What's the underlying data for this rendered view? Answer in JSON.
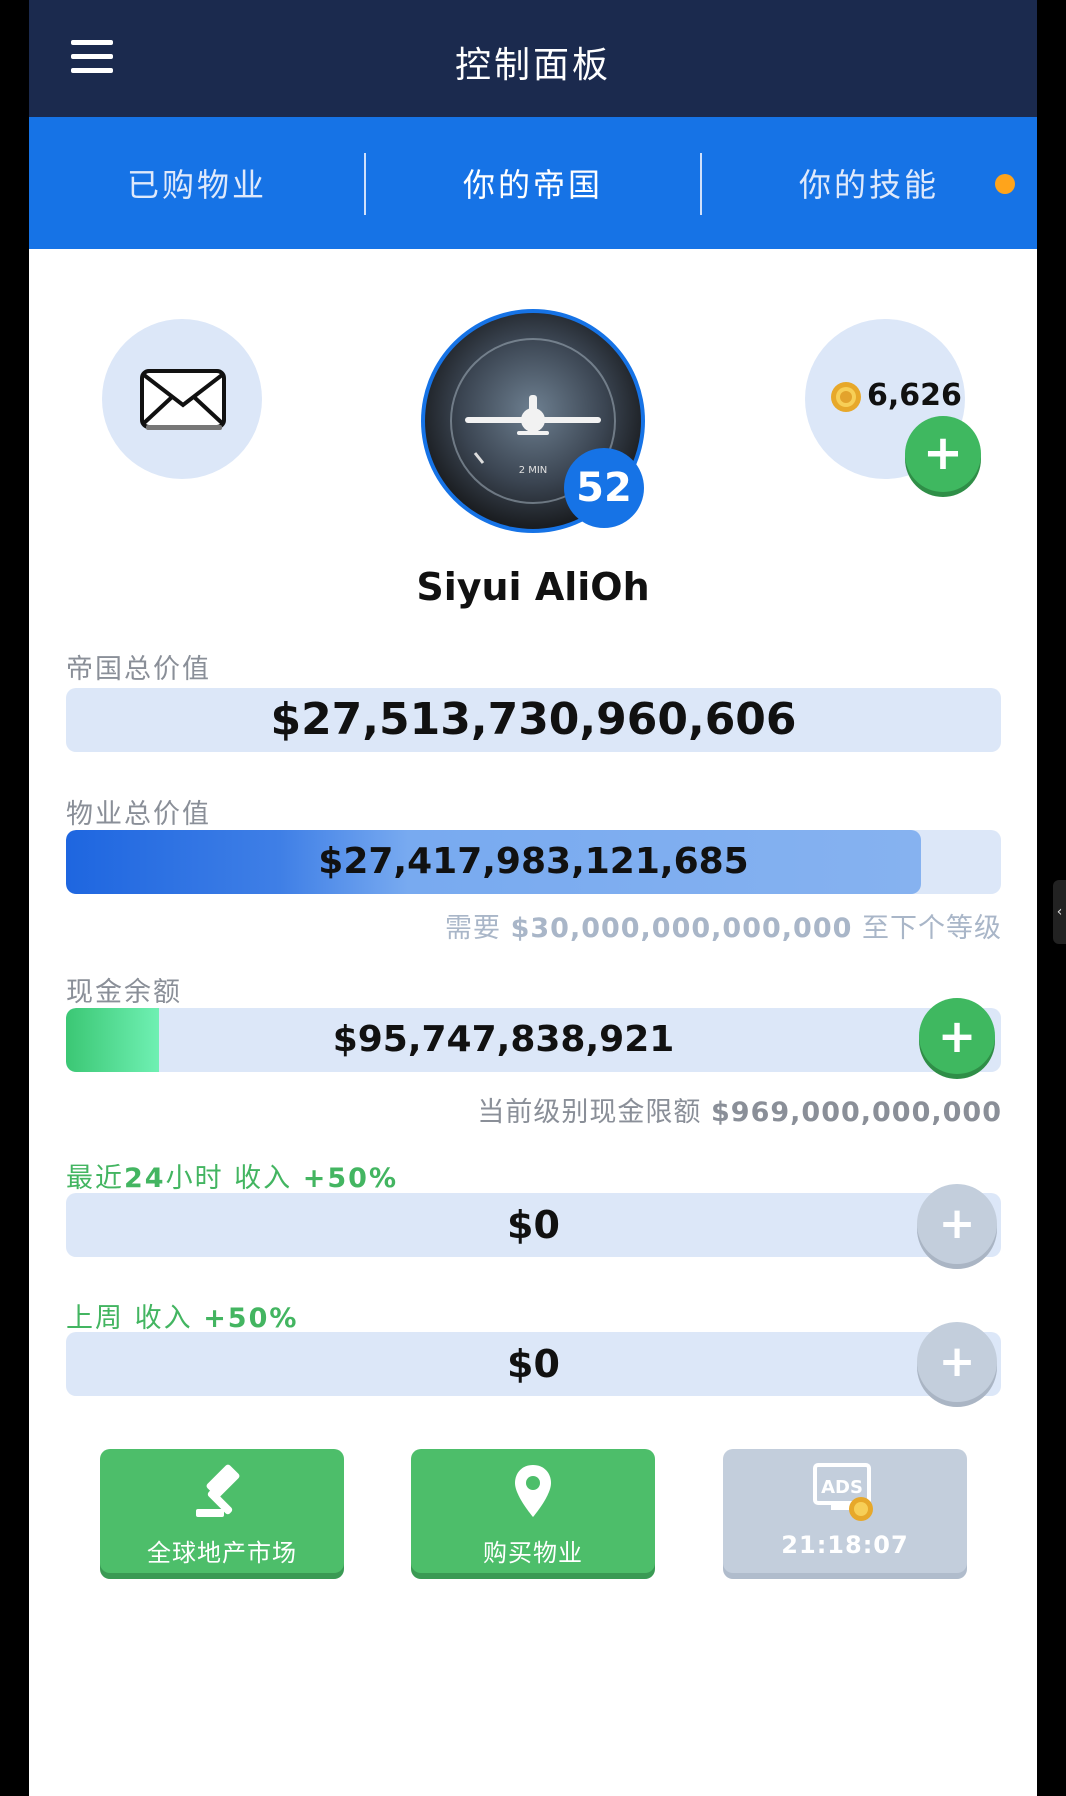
{
  "appbar": {
    "title": "控制面板",
    "menu_icon": "hamburger-menu-icon"
  },
  "tabs": [
    {
      "label": "已购物业",
      "active": false
    },
    {
      "label": "你的帝国",
      "active": true
    },
    {
      "label": "你的技能",
      "active": false,
      "has_badge_dot": true
    }
  ],
  "colors": {
    "appbar": "#1b2a4e",
    "tabbar": "#1673e6",
    "green": "#4dbe6a",
    "badge_dot": "#ffa41b"
  },
  "profile": {
    "name": "Siyui AliOh",
    "level": "52",
    "coins": "6,626",
    "icons": {
      "mail": "mail-icon",
      "coin": "coin-icon",
      "avatar": "turn-coordinator-gauge-image"
    }
  },
  "empire_value": {
    "label": "帝国总价值",
    "value": "$27,513,730,960,606"
  },
  "property_value": {
    "label": "物业总价值",
    "value": "$27,417,983,121,685",
    "progress_fraction": 0.914,
    "next_level_prefix": "需要",
    "next_level_amount": "$30,000,000,000,000",
    "next_level_suffix": "至下个等级"
  },
  "cash": {
    "label": "现金余额",
    "value": "$95,747,838,921",
    "fill_fraction": 0.099,
    "limit_label": "当前级别现金限额",
    "limit_value": "$969,000,000,000"
  },
  "income_24h": {
    "label_a": "最近",
    "label_b": "24",
    "label_c": "小时 收入",
    "bonus": "+50%",
    "value": "$0"
  },
  "income_week": {
    "label_a": "上周 收入",
    "bonus": "+50%",
    "value": "$0"
  },
  "actions": [
    {
      "label": "全球地产市场",
      "icon": "auction-gavel-icon",
      "enabled": true
    },
    {
      "label": "购买物业",
      "icon": "location-pin-icon",
      "enabled": true
    },
    {
      "label": "21:18:07",
      "icon": "ads-coin-icon",
      "enabled": false
    }
  ],
  "plus_symbol": "+"
}
